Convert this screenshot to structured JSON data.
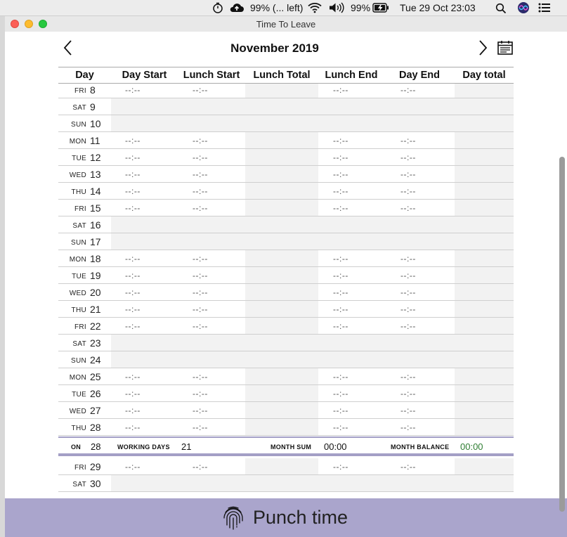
{
  "menubar": {
    "battery_app_text": "99% (... left)",
    "battery_percent": "99%",
    "datetime": "Tue 29 Oct  23:03"
  },
  "window": {
    "title": "Time To Leave"
  },
  "header": {
    "month_title": "November 2019"
  },
  "columns": [
    "Day",
    "Day Start",
    "Lunch Start",
    "Lunch Total",
    "Lunch End",
    "Day End",
    "Day total"
  ],
  "empty_time": "--:--",
  "rows_top": [
    {
      "wd": "FRI",
      "d": "8",
      "work": true
    },
    {
      "wd": "SAT",
      "d": "9",
      "work": false
    },
    {
      "wd": "SUN",
      "d": "10",
      "work": false
    },
    {
      "wd": "MON",
      "d": "11",
      "work": true
    },
    {
      "wd": "TUE",
      "d": "12",
      "work": true
    },
    {
      "wd": "WED",
      "d": "13",
      "work": true
    },
    {
      "wd": "THU",
      "d": "14",
      "work": true
    },
    {
      "wd": "FRI",
      "d": "15",
      "work": true
    },
    {
      "wd": "SAT",
      "d": "16",
      "work": false
    },
    {
      "wd": "SUN",
      "d": "17",
      "work": false
    },
    {
      "wd": "MON",
      "d": "18",
      "work": true
    },
    {
      "wd": "TUE",
      "d": "19",
      "work": true
    },
    {
      "wd": "WED",
      "d": "20",
      "work": true
    },
    {
      "wd": "THU",
      "d": "21",
      "work": true
    },
    {
      "wd": "FRI",
      "d": "22",
      "work": true
    },
    {
      "wd": "SAT",
      "d": "23",
      "work": false
    },
    {
      "wd": "SUN",
      "d": "24",
      "work": false
    },
    {
      "wd": "MON",
      "d": "25",
      "work": true
    },
    {
      "wd": "TUE",
      "d": "26",
      "work": true
    },
    {
      "wd": "WED",
      "d": "27",
      "work": true
    },
    {
      "wd": "THU",
      "d": "28",
      "work": true
    }
  ],
  "summary": {
    "on_label": "ON",
    "on_day": "28",
    "working_days_label": "WORKING DAYS",
    "working_days": "21",
    "month_sum_label": "MONTH SUM",
    "month_sum": "00:00",
    "month_balance_label": "MONTH BALANCE",
    "month_balance": "00:00",
    "balance_color": "#2e7d32"
  },
  "rows_bottom": [
    {
      "wd": "FRI",
      "d": "29",
      "work": true
    },
    {
      "wd": "SAT",
      "d": "30",
      "work": false
    }
  ],
  "punch": {
    "label": "Punch time"
  },
  "colors": {
    "accent": "#aaa5cc",
    "shade": "#f2f2f2"
  }
}
